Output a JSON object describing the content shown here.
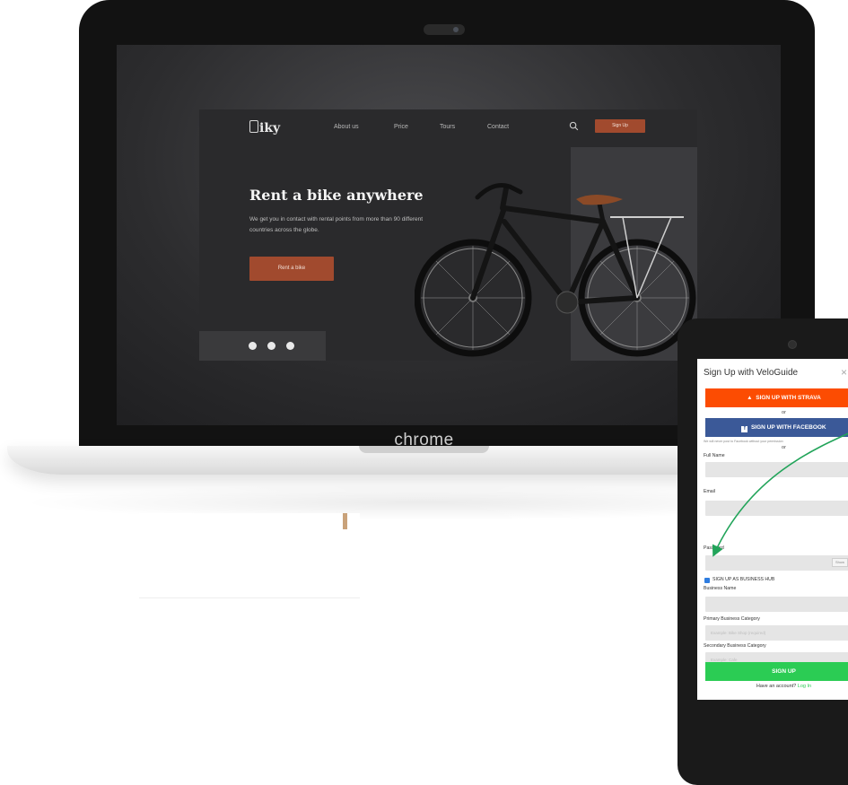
{
  "laptop": {
    "brand_label": "chrome"
  },
  "site": {
    "logo": "iky",
    "nav": [
      "About us",
      "Price",
      "Tours",
      "Contact"
    ],
    "signup_label": "Sign Up",
    "hero_title": "Rent a bike anywhere",
    "hero_subtitle": "We get you in contact with rental points from more than 90 different countries across the globe.",
    "cta_label": "Rent a bike",
    "social_icons": [
      "facebook-icon",
      "instagram-icon",
      "telegram-icon"
    ],
    "colors": {
      "accent": "#a14a2e",
      "background": "#2a2a2c"
    }
  },
  "form": {
    "title": "Sign Up with VeloGuide",
    "close_glyph": "×",
    "strava_label": "SIGN UP WITH STRAVA",
    "or_text": "or",
    "facebook_label": "SIGN UP WITH FACEBOOK",
    "facebook_note": "We will never post to Facebook without your permission",
    "full_name_label": "Full Name",
    "email_label": "Email",
    "password_label": "Password",
    "show_label": "Show",
    "business_checkbox_label": "SIGN UP AS BUSINESS HUB",
    "business_checkbox_checked": true,
    "business_name_label": "Business Name",
    "primary_category_label": "Primary Business Category",
    "primary_category_placeholder": "Example: Bike Shop (required)",
    "secondary_category_label": "Secondary Business Category",
    "secondary_category_placeholder": "Example: Cafe",
    "signup_label": "SIGN UP",
    "have_account_text": "Have an account?",
    "login_label": "Log In",
    "colors": {
      "strava": "#fc4c02",
      "facebook": "#3b5998",
      "signup": "#2bcc54",
      "arrow": "#22a45a"
    }
  }
}
